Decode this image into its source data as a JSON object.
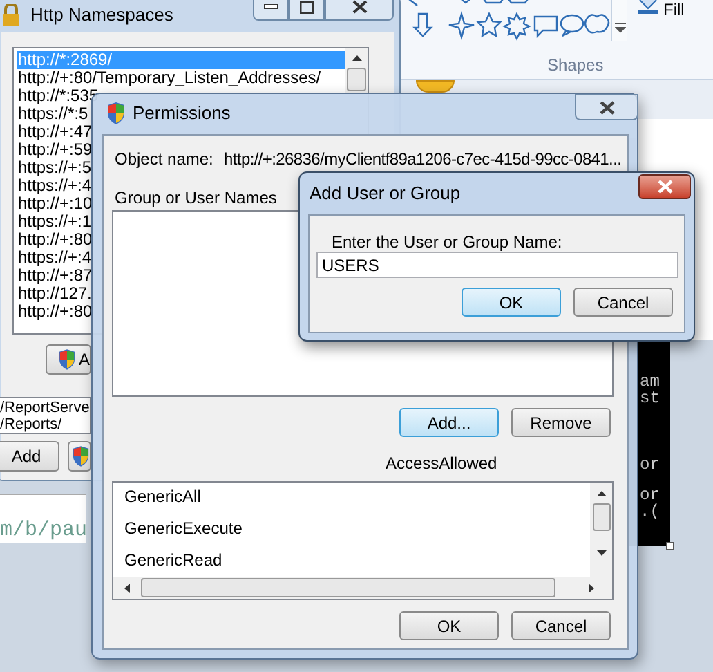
{
  "paint_ribbon": {
    "group_label": "Shapes",
    "fill_label": "Fill"
  },
  "http_namespaces": {
    "title": "Http Namespaces",
    "items": [
      {
        "text": "http://*:2869/",
        "selected": true
      },
      {
        "text": "http://+:80/Temporary_Listen_Addresses/",
        "selected": false
      },
      {
        "text": "http://*:535",
        "selected": false
      },
      {
        "text": "https://*:5",
        "selected": false
      },
      {
        "text": "http://+:47",
        "selected": false
      },
      {
        "text": "http://+:59",
        "selected": false
      },
      {
        "text": "https://+:5",
        "selected": false
      },
      {
        "text": "https://+:4",
        "selected": false
      },
      {
        "text": "http://+:10",
        "selected": false
      },
      {
        "text": "https://+:1",
        "selected": false
      },
      {
        "text": "http://+:80",
        "selected": false
      },
      {
        "text": "https://+:4",
        "selected": false
      },
      {
        "text": "http://+:87",
        "selected": false
      },
      {
        "text": "http://127.",
        "selected": false
      },
      {
        "text": "http://+:80",
        "selected": false
      }
    ],
    "shield_button_label": "A",
    "reservations": [
      "/ReportServe",
      "/Reports/"
    ],
    "add_button": "Add"
  },
  "browser": {
    "text": "m/b/pau"
  },
  "console": {
    "lines": [
      "am",
      "st",
      "or",
      "or",
      ".("
    ]
  },
  "permissions": {
    "title": "Permissions",
    "object_name_label": "Object name:",
    "object_name": "http://+:26836/myClientf89a1206-c7ec-415d-99cc-0841...",
    "group_label": "Group or User Names",
    "buttons": [
      {
        "label": "Add...",
        "focused": true
      },
      {
        "label": "Remove",
        "focused": false
      }
    ],
    "access_label": "AccessAllowed",
    "access_items": [
      "GenericAll",
      "GenericExecute",
      "GenericRead"
    ],
    "footer_buttons": [
      {
        "label": "OK",
        "focused": false
      },
      {
        "label": "Cancel",
        "focused": false
      }
    ]
  },
  "add_user_dialog": {
    "title": "Add User or Group",
    "prompt": "Enter the User or Group Name:",
    "value": "USERS",
    "buttons": [
      {
        "label": "OK",
        "focused": true
      },
      {
        "label": "Cancel",
        "focused": false
      }
    ]
  }
}
